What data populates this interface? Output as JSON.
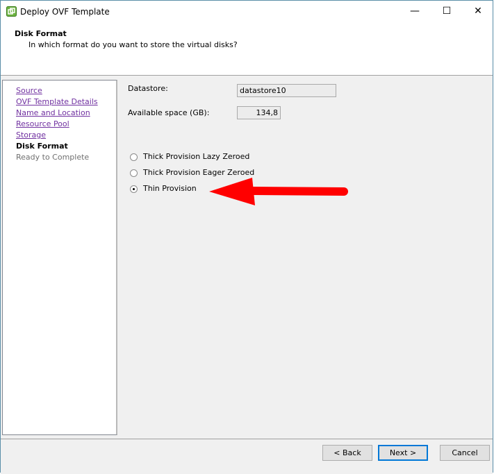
{
  "window": {
    "title": "Deploy OVF Template",
    "minimize": "—",
    "maximize": "☐",
    "close": "✕"
  },
  "header": {
    "title": "Disk Format",
    "subtitle": "In which format do you want to store the virtual disks?"
  },
  "nav": {
    "items": [
      {
        "label": "Source",
        "state": "link"
      },
      {
        "label": "OVF Template Details",
        "state": "link"
      },
      {
        "label": "Name and Location",
        "state": "link"
      },
      {
        "label": "Resource Pool",
        "state": "link"
      },
      {
        "label": "Storage",
        "state": "link"
      },
      {
        "label": "Disk Format",
        "state": "current"
      },
      {
        "label": "Ready to Complete",
        "state": "disabled"
      }
    ]
  },
  "form": {
    "datastore_label": "Datastore:",
    "datastore_value": "datastore10",
    "space_label": "Available space (GB):",
    "space_value": "134,8",
    "options": [
      {
        "label": "Thick Provision Lazy Zeroed",
        "checked": false
      },
      {
        "label": "Thick Provision Eager Zeroed",
        "checked": false
      },
      {
        "label": "Thin Provision",
        "checked": true
      }
    ]
  },
  "annotation": {
    "arrow_color": "#ff0000"
  },
  "footer": {
    "back": "< Back",
    "next": "Next >",
    "cancel": "Cancel"
  }
}
